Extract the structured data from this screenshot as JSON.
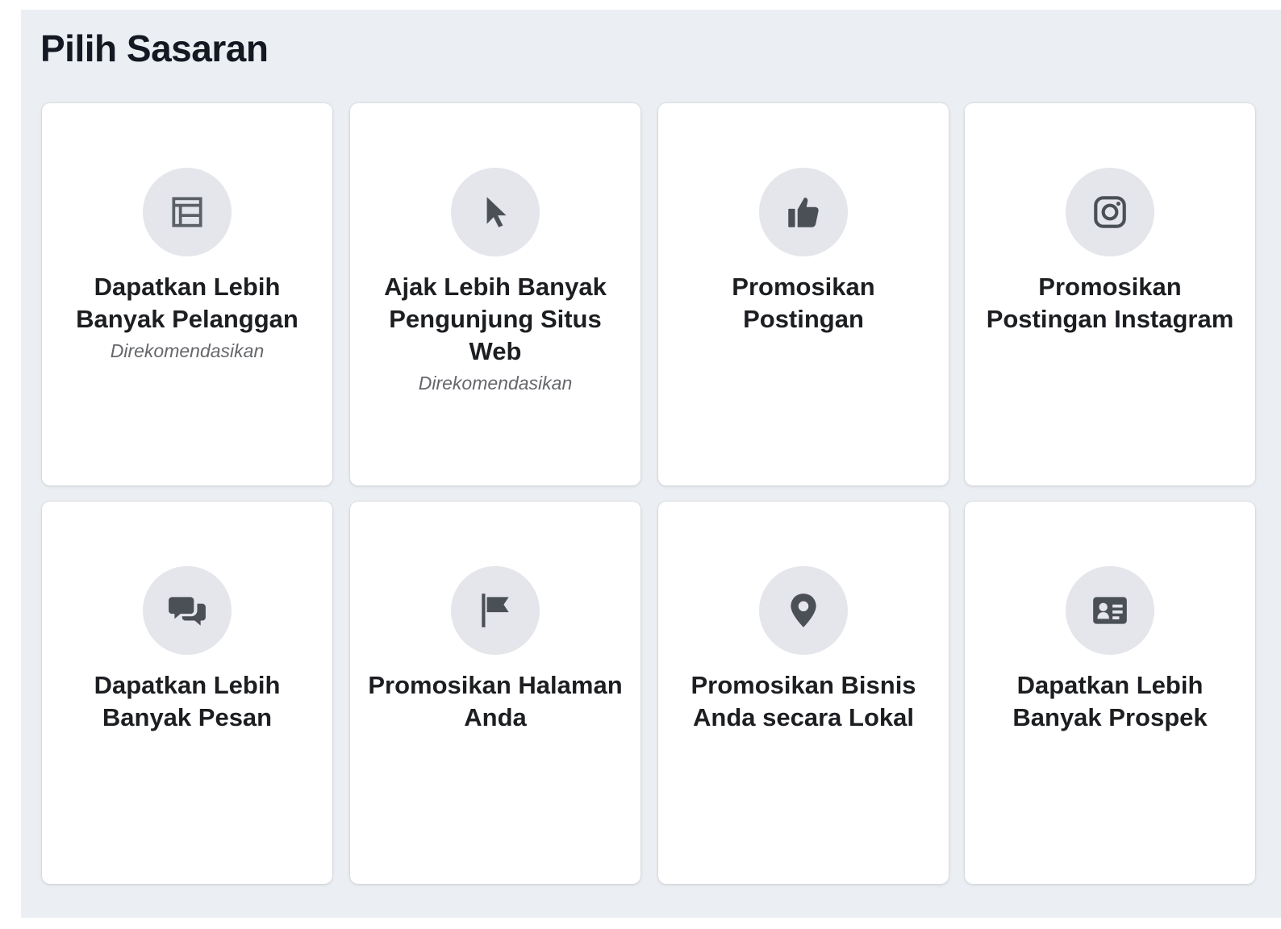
{
  "header": {
    "title": "Pilih Sasaran"
  },
  "objectives": [
    {
      "label": "Dapatkan Lebih Banyak Pelanggan",
      "sublabel": "Direkomendasikan",
      "icon": "storefront-icon"
    },
    {
      "label": "Ajak Lebih Banyak Pengunjung Situs Web",
      "sublabel": "Direkomendasikan",
      "icon": "cursor-icon"
    },
    {
      "label": "Promosikan Postingan",
      "icon": "thumbs-up-icon"
    },
    {
      "label": "Promosikan Postingan Instagram",
      "icon": "instagram-icon"
    },
    {
      "label": "Dapatkan Lebih Banyak Pesan",
      "icon": "chat-bubbles-icon"
    },
    {
      "label": "Promosikan Halaman Anda",
      "icon": "flag-icon"
    },
    {
      "label": "Promosikan Bisnis Anda secara Lokal",
      "icon": "location-pin-icon"
    },
    {
      "label": "Dapatkan Lebih Banyak Prospek",
      "icon": "contact-card-icon"
    }
  ],
  "colors": {
    "panel_bg": "#ebeef2",
    "icon_bg": "#e4e6eb",
    "icon_fg": "#4b4f56",
    "text": "#1c1e21"
  }
}
